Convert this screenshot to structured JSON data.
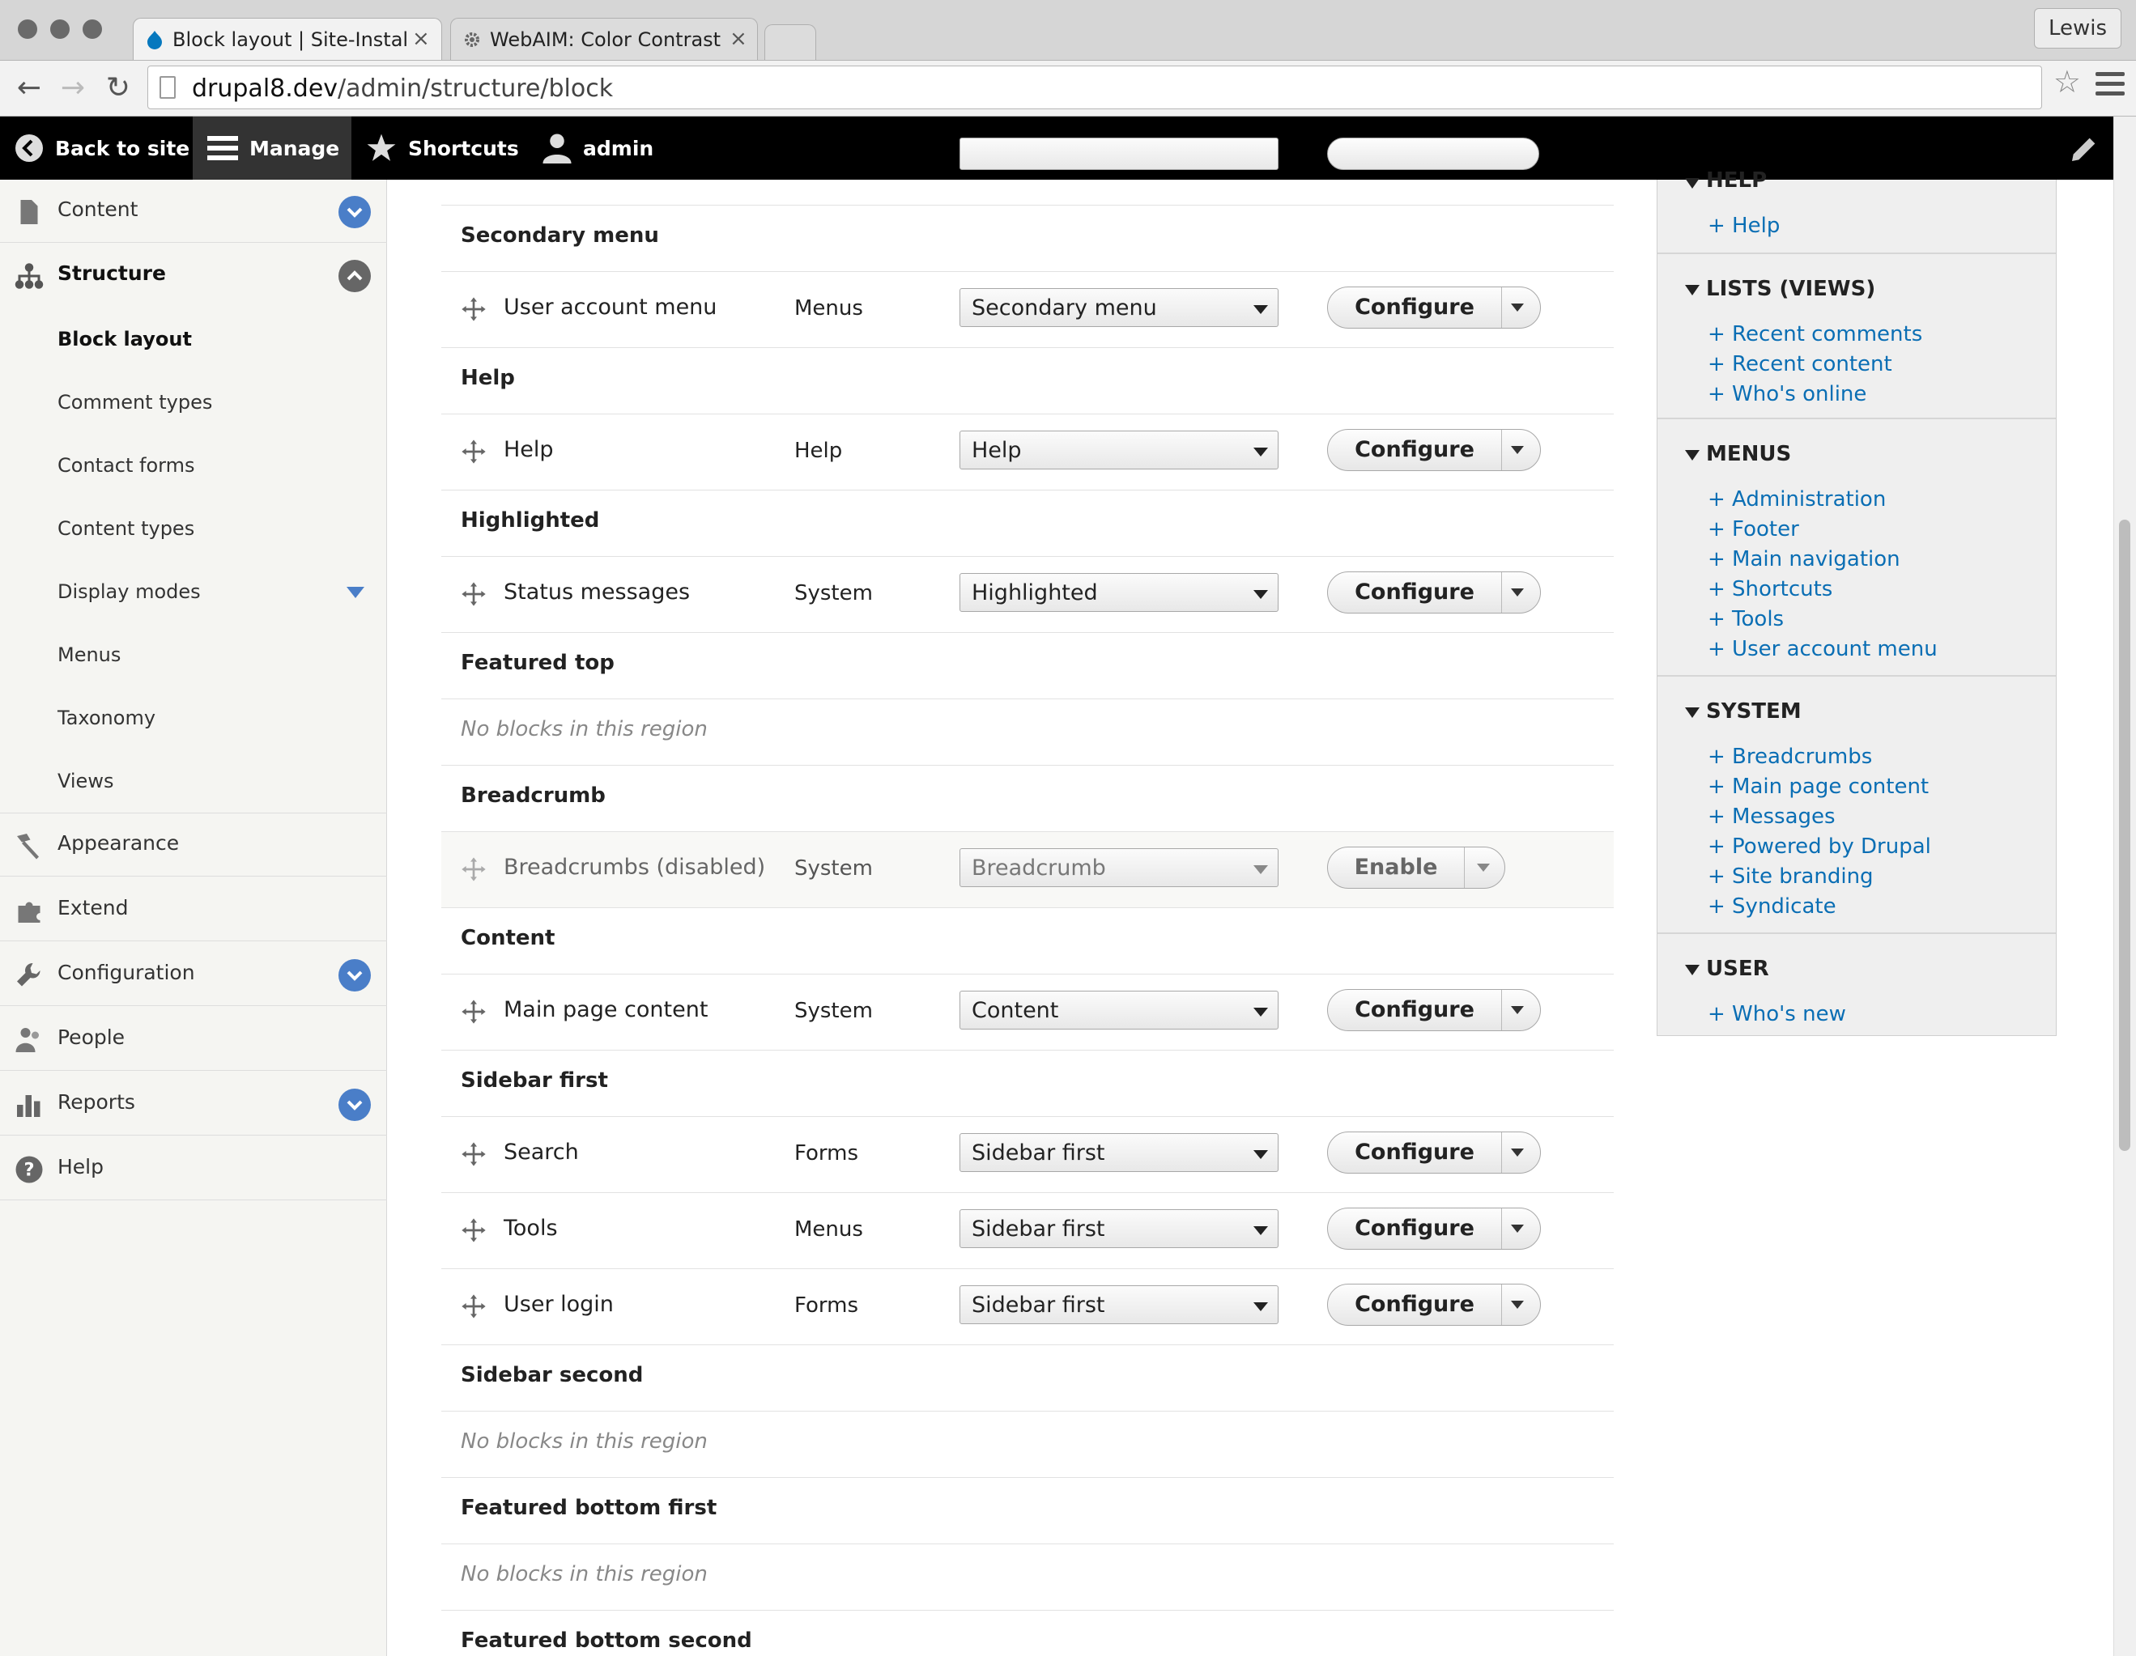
{
  "browser": {
    "tabs": [
      {
        "title": "Block layout | Site-Install",
        "close": "×"
      },
      {
        "title": "WebAIM: Color Contrast Che",
        "close": "×"
      }
    ],
    "profile": "Lewis",
    "url_host": "drupal8.dev",
    "url_path": "/admin/structure/block"
  },
  "toolbar": {
    "back_to_site": "Back to site",
    "manage": "Manage",
    "shortcuts": "Shortcuts",
    "user": "admin"
  },
  "sidebar": {
    "content": "Content",
    "structure": "Structure",
    "structure_children": [
      "Block layout",
      "Comment types",
      "Contact forms",
      "Content types",
      "Display modes",
      "Menus",
      "Taxonomy",
      "Views"
    ],
    "appearance": "Appearance",
    "extend": "Extend",
    "configuration": "Configuration",
    "people": "People",
    "reports": "Reports",
    "help": "Help"
  },
  "main": {
    "regions": {
      "secondary_menu": "Secondary menu",
      "help": "Help",
      "highlighted": "Highlighted",
      "featured_top": "Featured top",
      "breadcrumb": "Breadcrumb",
      "content": "Content",
      "sidebar_first": "Sidebar first",
      "sidebar_second": "Sidebar second",
      "featured_bottom_first": "Featured bottom first",
      "featured_bottom_second": "Featured bottom second"
    },
    "empty_text": "No blocks in this region",
    "blocks": [
      {
        "name": "User account menu",
        "category": "Menus",
        "region": "Secondary menu",
        "op": "Configure"
      },
      {
        "name": "Help",
        "category": "Help",
        "region": "Help",
        "op": "Configure"
      },
      {
        "name": "Status messages",
        "category": "System",
        "region": "Highlighted",
        "op": "Configure"
      },
      {
        "name": "Breadcrumbs (disabled)",
        "category": "System",
        "region": "Breadcrumb",
        "op": "Enable"
      },
      {
        "name": "Main page content",
        "category": "System",
        "region": "Content",
        "op": "Configure"
      },
      {
        "name": "Search",
        "category": "Forms",
        "region": "Sidebar first",
        "op": "Configure"
      },
      {
        "name": "Tools",
        "category": "Menus",
        "region": "Sidebar first",
        "op": "Configure"
      },
      {
        "name": "User login",
        "category": "Forms",
        "region": "Sidebar first",
        "op": "Configure"
      }
    ]
  },
  "library": {
    "help": {
      "title": "HELP",
      "links": [
        "+ Help"
      ]
    },
    "lists": {
      "title": "LISTS (VIEWS)",
      "links": [
        "+ Recent comments",
        "+ Recent content",
        "+ Who's online"
      ]
    },
    "menus": {
      "title": "MENUS",
      "links": [
        "+ Administration",
        "+ Footer",
        "+ Main navigation",
        "+ Shortcuts",
        "+ Tools",
        "+ User account menu"
      ]
    },
    "system": {
      "title": "SYSTEM",
      "links": [
        "+ Breadcrumbs",
        "+ Main page content",
        "+ Messages",
        "+ Powered by Drupal",
        "+ Site branding",
        "+ Syndicate"
      ]
    },
    "user": {
      "title": "USER",
      "links": [
        "+ Who's new"
      ]
    }
  }
}
